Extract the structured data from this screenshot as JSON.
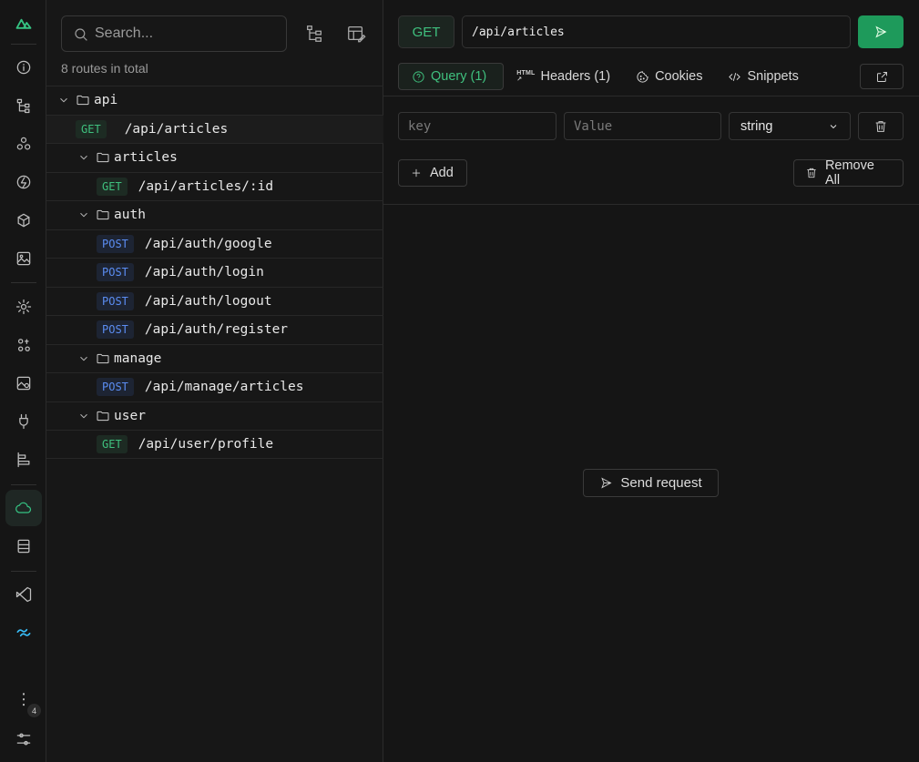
{
  "sidebar": {
    "search_placeholder": "Search...",
    "total_label": "8 routes in total"
  },
  "tree": [
    {
      "kind": "folder",
      "level": 0,
      "label": "api"
    },
    {
      "kind": "route",
      "level": 0,
      "method": "GET",
      "path": "/api/articles",
      "selected": true
    },
    {
      "kind": "folder",
      "level": 1,
      "label": "articles"
    },
    {
      "kind": "route",
      "level": 1,
      "method": "GET",
      "path": "/api/articles/:id"
    },
    {
      "kind": "folder",
      "level": 1,
      "label": "auth"
    },
    {
      "kind": "route",
      "level": 1,
      "method": "POST",
      "path": "/api/auth/google"
    },
    {
      "kind": "route",
      "level": 1,
      "method": "POST",
      "path": "/api/auth/login"
    },
    {
      "kind": "route",
      "level": 1,
      "method": "POST",
      "path": "/api/auth/logout"
    },
    {
      "kind": "route",
      "level": 1,
      "method": "POST",
      "path": "/api/auth/register"
    },
    {
      "kind": "folder",
      "level": 1,
      "label": "manage"
    },
    {
      "kind": "route",
      "level": 1,
      "method": "POST",
      "path": "/api/manage/articles"
    },
    {
      "kind": "folder",
      "level": 1,
      "label": "user"
    },
    {
      "kind": "route",
      "level": 1,
      "method": "GET",
      "path": "/api/user/profile"
    }
  ],
  "request": {
    "method": "GET",
    "url": "/api/articles",
    "send_label": "Send request"
  },
  "tabs": [
    {
      "label": "Query (1)",
      "icon": "question-circle-icon",
      "active": true
    },
    {
      "label": "Headers (1)",
      "icon": "html-icon"
    },
    {
      "label": "Cookies",
      "icon": "cookie-icon"
    },
    {
      "label": "Snippets",
      "icon": "code-icon"
    }
  ],
  "params": {
    "key_placeholder": "key",
    "value_placeholder": "Value",
    "type_value": "string",
    "add_label": "Add",
    "remove_all_label": "Remove All"
  },
  "activity_badge": "4",
  "colors": {
    "accent": "#35c282",
    "get": "#3fc07e",
    "post": "#5b8df2",
    "send_button": "#1e9a5b"
  }
}
